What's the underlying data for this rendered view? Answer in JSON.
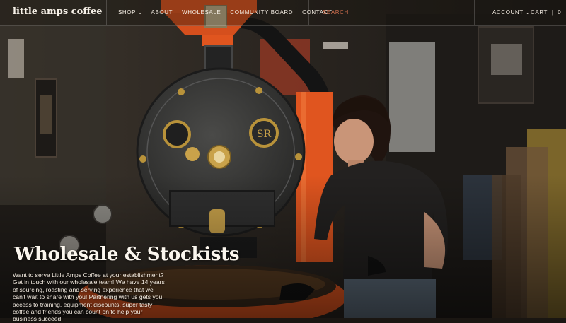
{
  "brand": {
    "logo_text": "little amps coffee"
  },
  "nav": {
    "items": [
      {
        "label": "SHOP",
        "has_dropdown": true
      },
      {
        "label": "ABOUT"
      },
      {
        "label": "WHOLESALE"
      },
      {
        "label": "COMMUNITY BOARD"
      },
      {
        "label": "CONTACT"
      }
    ],
    "search_label": "SEARCH",
    "account_label": "ACCOUNT",
    "cart_label": "CART",
    "cart_count": "0",
    "dropdown_glyph": "⌄"
  },
  "hero": {
    "title": "Wholesale & Stockists",
    "description": "Want to serve Little Amps Coffee at your establishment? Get in touch with our wholesale team! We have 14 years of sourcing, roasting and serving experience that we can't wait to share with you! Partnering with us gets you access to training, equipment discounts, super tasty coffee,and friends you can count on to help your business succeed!"
  },
  "colors": {
    "roaster_orange": "#e0551f",
    "roaster_body": "#3a3a3a",
    "brass": "#b8923a",
    "search_accent": "#c96b4b"
  }
}
